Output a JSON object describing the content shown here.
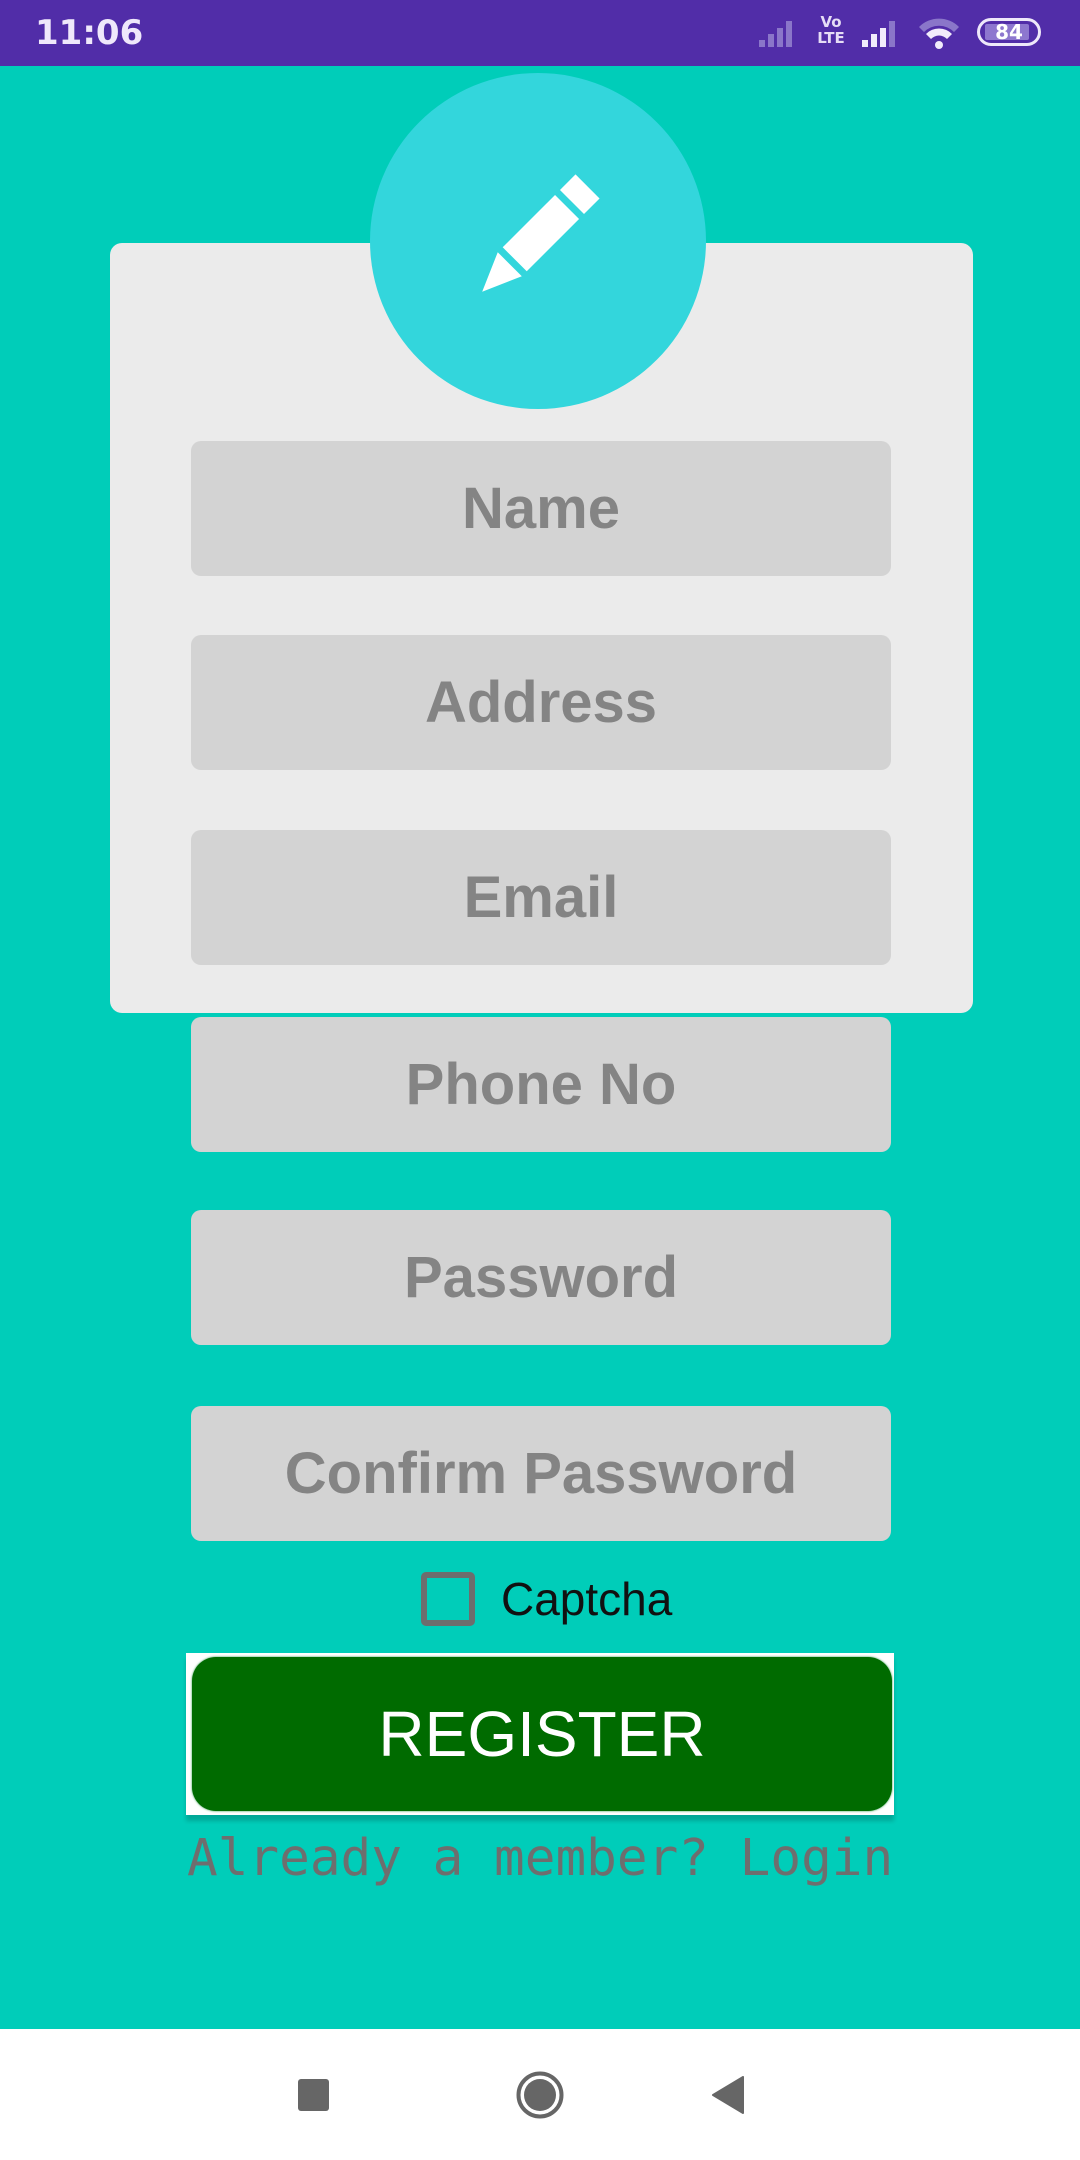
{
  "status_bar": {
    "time": "11:06",
    "volte_line1": "Vo",
    "volte_line2": "LTE",
    "battery_level": "84",
    "icons": [
      "signal-icon",
      "volte-icon",
      "signal-icon",
      "wifi-icon",
      "battery-icon"
    ]
  },
  "header": {
    "icon": "pencil-icon",
    "colors": {
      "background": "#00cdb9",
      "circle": "#33d6dc",
      "card": "#ebebeb"
    }
  },
  "form": {
    "fields": [
      {
        "name": "name",
        "placeholder": "Name",
        "value": ""
      },
      {
        "name": "address",
        "placeholder": "Address",
        "value": ""
      },
      {
        "name": "email",
        "placeholder": "Email",
        "value": ""
      },
      {
        "name": "phone",
        "placeholder": "Phone No",
        "value": ""
      },
      {
        "name": "password",
        "placeholder": "Password",
        "value": ""
      },
      {
        "name": "confirm-password",
        "placeholder": "Confirm Password",
        "value": ""
      }
    ],
    "captcha": {
      "label": "Captcha",
      "checked": false
    },
    "register_label": "REGISTER",
    "register_color": "#006b00",
    "login_text": "Already a member? Login"
  },
  "nav_bar": {
    "recents": "recents-icon",
    "home": "home-icon",
    "back": "back-icon"
  }
}
